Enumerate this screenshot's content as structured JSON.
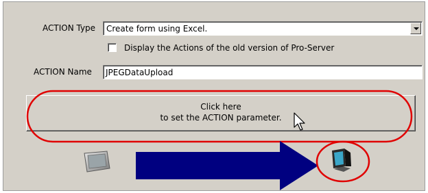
{
  "action_type": {
    "label": "ACTION Type",
    "selected": "Create form using Excel."
  },
  "old_version_checkbox": {
    "label": "Display the Actions of the old version of Pro-Server",
    "checked": false
  },
  "action_name": {
    "label": "ACTION Name",
    "value": "JPEGDataUpload"
  },
  "parameter_button": {
    "line1": "Click here",
    "line2": "to set the ACTION parameter."
  },
  "icons": {
    "source": "display-device-icon",
    "flow": "right-arrow-icon",
    "target": "pc-monitor-icon",
    "pointer": "mouse-cursor-icon"
  },
  "colors": {
    "highlight": "#e00000",
    "arrow": "#000080",
    "panel": "#d4d0c8"
  }
}
